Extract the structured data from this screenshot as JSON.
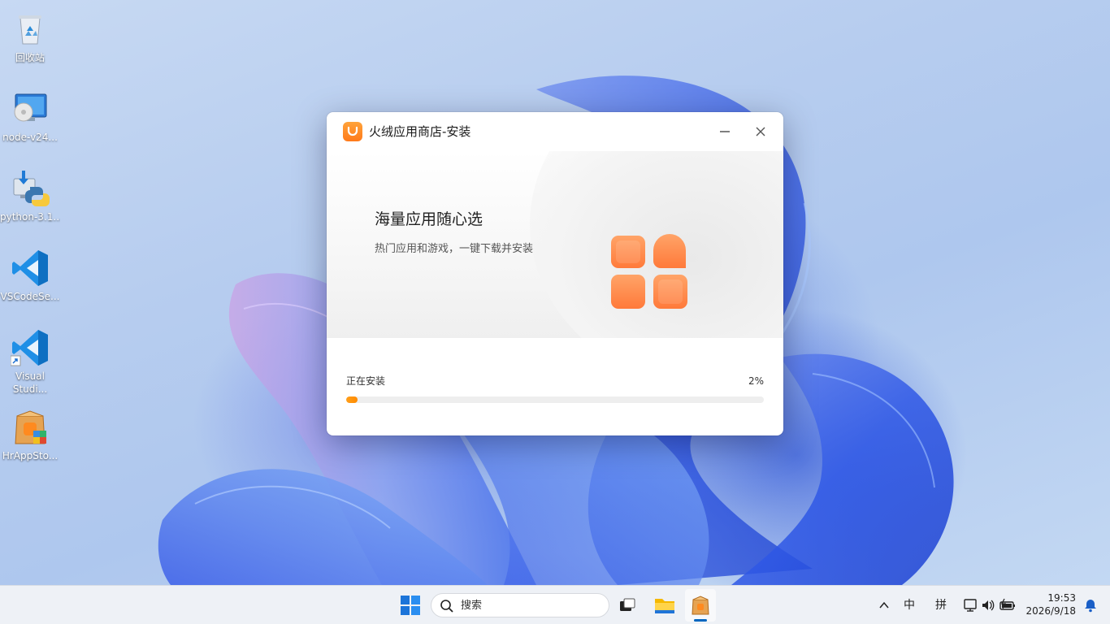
{
  "desktop": {
    "icons": [
      {
        "label": "回收站",
        "icon": "recycle-bin-icon"
      },
      {
        "label": "node-v24...",
        "icon": "node-installer-icon"
      },
      {
        "label": "python-3.1...",
        "icon": "python-installer-icon"
      },
      {
        "label": "VSCodeSe...",
        "icon": "vscode-icon"
      },
      {
        "label": "Visual Studi...",
        "icon": "vscode-shortcut-icon"
      },
      {
        "label": "HrAppSto...",
        "icon": "hrappstore-icon"
      }
    ]
  },
  "installer": {
    "title": "火绒应用商店-安装",
    "hero_title": "海量应用随心选",
    "hero_subtitle": "热门应用和游戏，一键下载并安装",
    "status": "正在安装",
    "percent_text": "2%",
    "progress": 0.02,
    "accent_color": "#ff8a00"
  },
  "taskbar": {
    "search_placeholder": "搜索",
    "ime_lang": "中",
    "ime_mode": "拼",
    "time": "19:53",
    "date": "2026/9/18"
  }
}
